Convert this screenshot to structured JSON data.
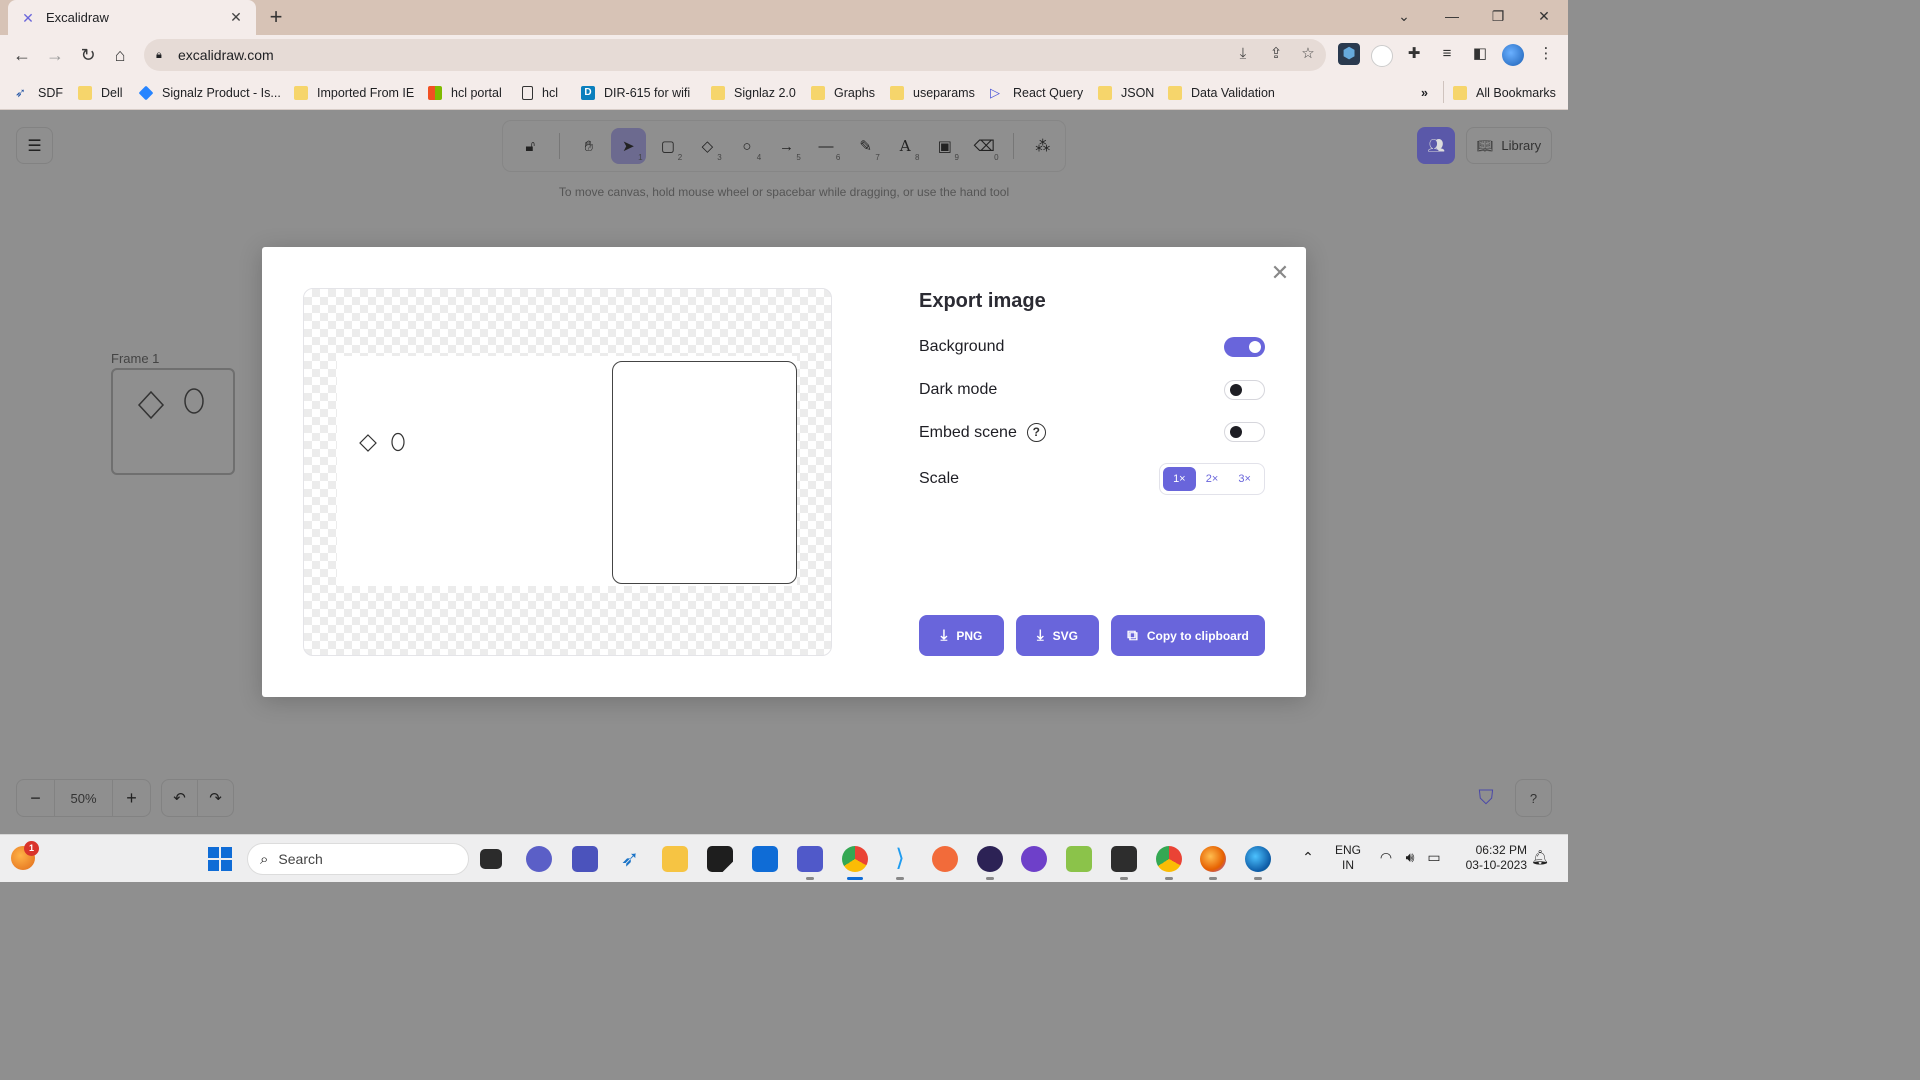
{
  "browser": {
    "tab_title": "Excalidraw",
    "tab_favicon": "excalidraw-icon",
    "url": "excalidraw.com",
    "bookmarks": [
      {
        "label": "SDF",
        "icon": "bird-icon"
      },
      {
        "label": "Dell",
        "icon": "folder-icon"
      },
      {
        "label": "Signalz Product - Is...",
        "icon": "jira-icon"
      },
      {
        "label": "Imported From IE",
        "icon": "folder-icon"
      },
      {
        "label": "hcl portal",
        "icon": "ms-icon"
      },
      {
        "label": "hcl",
        "icon": "page-icon"
      },
      {
        "label": "DIR-615 for wifi",
        "icon": "dlink-icon"
      },
      {
        "label": "Signlaz 2.0",
        "icon": "folder-icon"
      },
      {
        "label": "Graphs",
        "icon": "folder-icon"
      },
      {
        "label": "useparams",
        "icon": "folder-icon"
      },
      {
        "label": "React Query",
        "icon": "react-query-icon"
      },
      {
        "label": "JSON",
        "icon": "folder-icon"
      },
      {
        "label": "Data Validation",
        "icon": "folder-icon"
      }
    ],
    "overflow_label": "»",
    "all_bookmarks": "All Bookmarks"
  },
  "app": {
    "hint": "To move canvas, hold mouse wheel or spacebar while dragging, or use the hand tool",
    "tools": [
      {
        "icon": "lock-icon",
        "key": ""
      },
      {
        "icon": "hand-icon",
        "key": ""
      },
      {
        "icon": "pointer-icon",
        "key": "1"
      },
      {
        "icon": "rectangle-icon",
        "key": "2"
      },
      {
        "icon": "diamond-icon",
        "key": "3"
      },
      {
        "icon": "ellipse-icon",
        "key": "4"
      },
      {
        "icon": "arrow-icon",
        "key": "5"
      },
      {
        "icon": "line-icon",
        "key": "6"
      },
      {
        "icon": "pencil-icon",
        "key": "7"
      },
      {
        "icon": "text-icon",
        "key": "8"
      },
      {
        "icon": "image-icon",
        "key": "9"
      },
      {
        "icon": "eraser-icon",
        "key": "0"
      },
      {
        "icon": "shapes-icon",
        "key": ""
      }
    ],
    "active_tool": "pointer",
    "library_label": "Library",
    "frame_label": "Frame 1",
    "zoom": "50%",
    "accent": "#6965db"
  },
  "export_dialog": {
    "title": "Export image",
    "options": {
      "background": {
        "label": "Background",
        "on": true
      },
      "dark_mode": {
        "label": "Dark mode",
        "on": false
      },
      "embed_scene": {
        "label": "Embed scene",
        "on": false
      }
    },
    "help_glyph": "?",
    "scale_label": "Scale",
    "scale_options": [
      "1×",
      "2×",
      "3×"
    ],
    "scale_selected": "1×",
    "buttons": {
      "png": "PNG",
      "svg": "SVG",
      "clipboard": "Copy to clipboard"
    }
  },
  "taskbar": {
    "notification_count": "1",
    "search_placeholder": "Search",
    "language_line1": "ENG",
    "language_line2": "IN",
    "time": "06:32 PM",
    "date": "03-10-2023"
  }
}
